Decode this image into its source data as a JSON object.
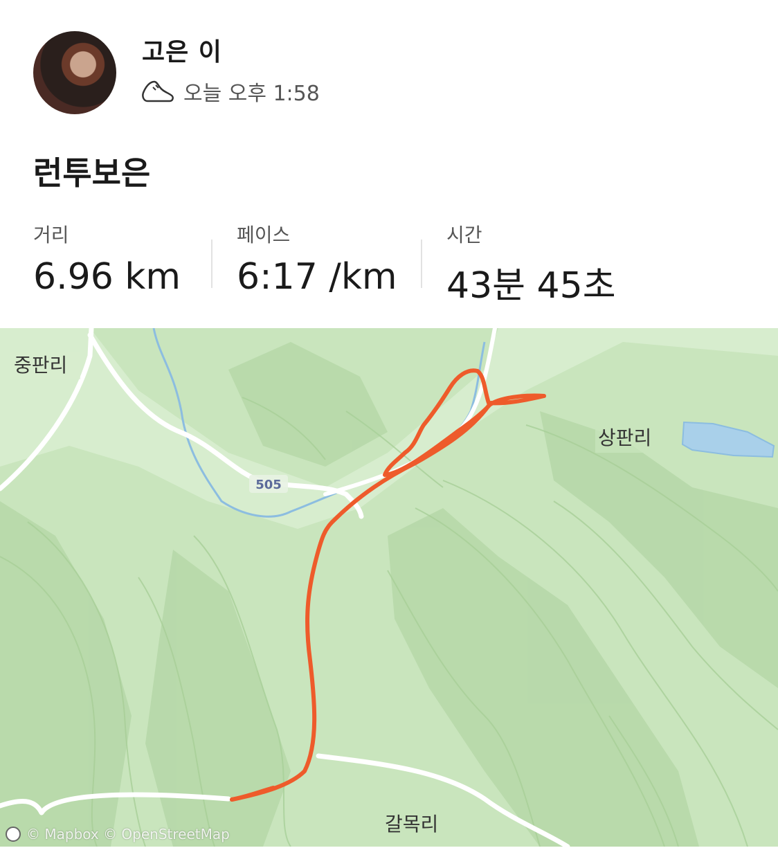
{
  "athlete": {
    "name": "고은 이",
    "activity_icon": "shoe-icon",
    "timestamp": "오늘 오후 1:58"
  },
  "activity": {
    "title": "런투보은"
  },
  "stats": [
    {
      "label": "거리",
      "value": "6.96 km"
    },
    {
      "label": "페이스",
      "value": "6:17 /km"
    },
    {
      "label": "시간",
      "value": "43분 45초"
    }
  ],
  "map": {
    "places": {
      "jungpan": "중판리",
      "sangpan": "상판리",
      "galmok": "갈목리"
    },
    "road_number": "505",
    "attribution": "© Mapbox © OpenStreetMap",
    "route_color": "#ee5b2b",
    "terrain_color": "#cfe8c2"
  }
}
